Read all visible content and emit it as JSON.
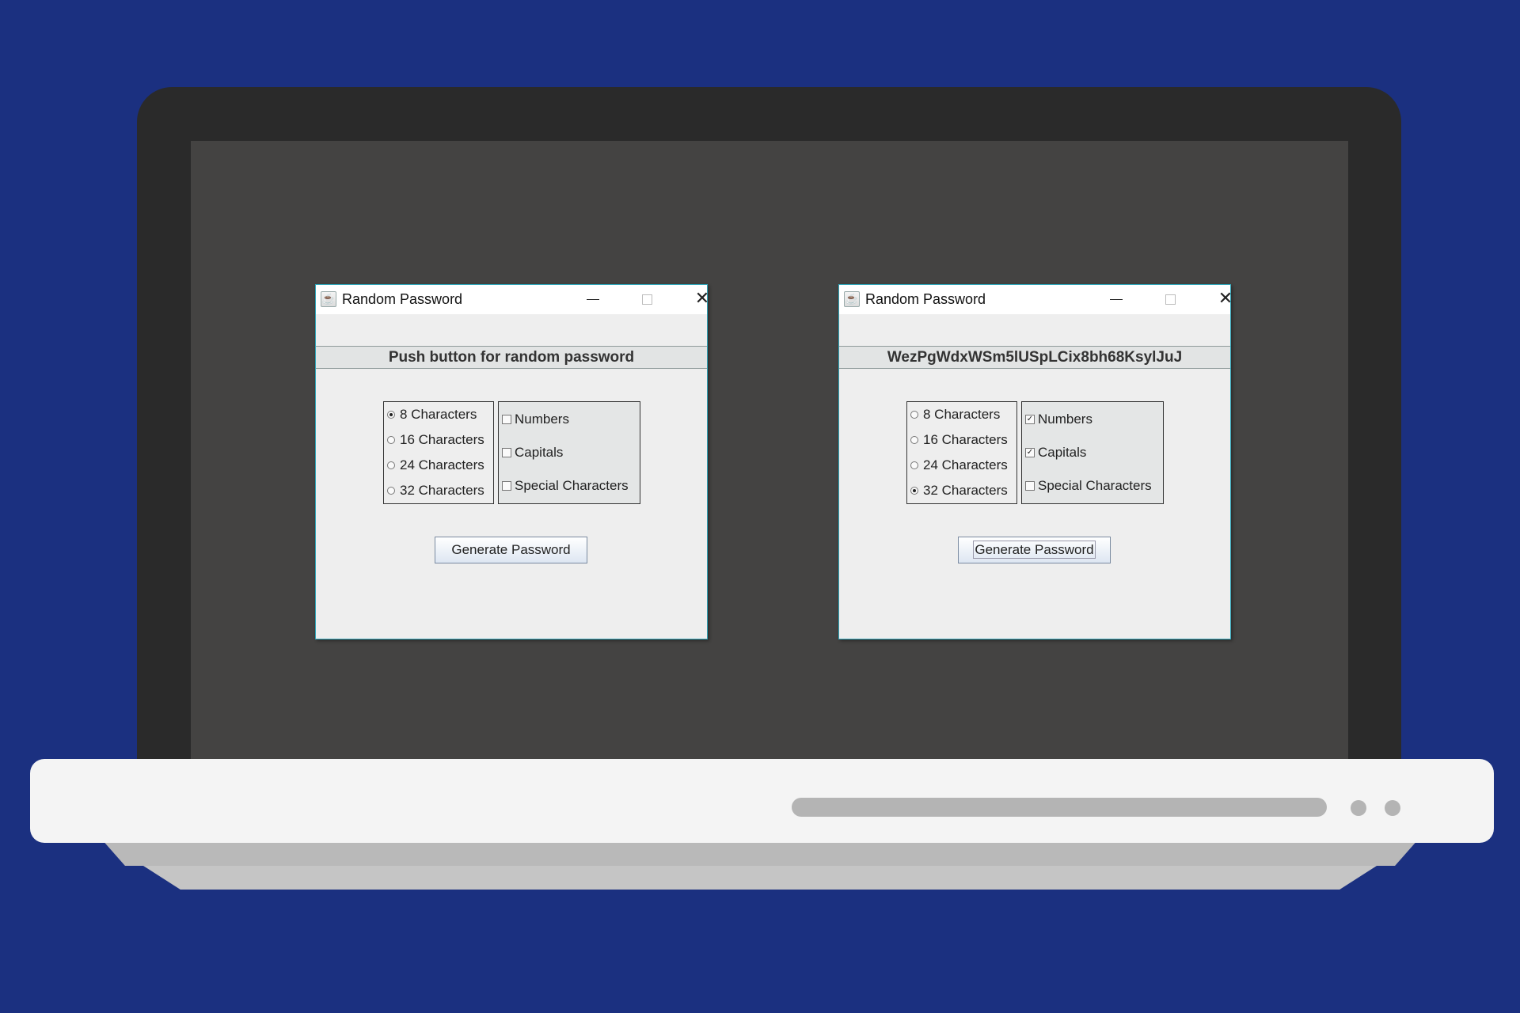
{
  "windows": [
    {
      "title": "Random Password",
      "password_label": "Push button for random password",
      "lengths": [
        {
          "label": "8 Characters",
          "selected": true
        },
        {
          "label": "16 Characters",
          "selected": false
        },
        {
          "label": "24 Characters",
          "selected": false
        },
        {
          "label": "32 Characters",
          "selected": false
        }
      ],
      "options": [
        {
          "label": "Numbers",
          "checked": false
        },
        {
          "label": "Capitals",
          "checked": false
        },
        {
          "label": "Special Characters",
          "checked": false
        }
      ],
      "generate_label": "Generate Password"
    },
    {
      "title": "Random Password",
      "password_label": "WezPgWdxWSm5lUSpLCix8bh68KsylJuJ",
      "lengths": [
        {
          "label": "8 Characters",
          "selected": false
        },
        {
          "label": "16 Characters",
          "selected": false
        },
        {
          "label": "24 Characters",
          "selected": false
        },
        {
          "label": "32 Characters",
          "selected": true
        }
      ],
      "options": [
        {
          "label": "Numbers",
          "checked": true
        },
        {
          "label": "Capitals",
          "checked": true
        },
        {
          "label": "Special Characters",
          "checked": false
        }
      ],
      "generate_label": "Generate Password"
    }
  ],
  "icons": {
    "app": "java-cup-icon",
    "minimize": "minimize-icon",
    "maximize": "maximize-icon",
    "close": "close-icon"
  },
  "colors": {
    "background": "#1b3080",
    "laptop_lid": "#2a2a2a",
    "screen": "#444342",
    "laptop_base": "#f4f4f4",
    "window_border": "#2fa4b8"
  }
}
